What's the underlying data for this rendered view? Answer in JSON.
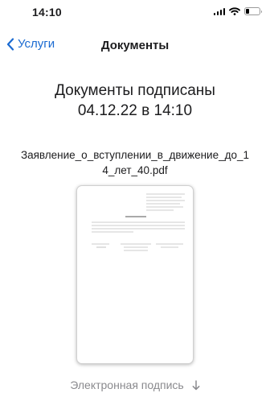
{
  "status_bar": {
    "time": "14:10",
    "icons": [
      "cellular-signal-icon",
      "wifi-icon",
      "battery-icon"
    ],
    "battery_level": 0.25
  },
  "nav": {
    "back_label": "Услуги",
    "title": "Документы",
    "accent_color": "#1a6ad1"
  },
  "main": {
    "signed_line1": "Документы подписаны",
    "signed_line2": "04.12.22 в 14:10",
    "file_name": "Заявление_о_вступлении_в_движение_до_1\n4_лет_40.pdf",
    "signature_label": "Электронная подпись",
    "signature_icon": "arrow-down-icon"
  }
}
